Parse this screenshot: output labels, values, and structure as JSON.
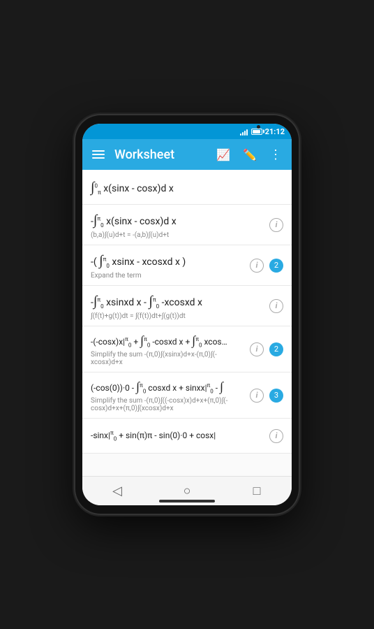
{
  "status_bar": {
    "time": "21:12"
  },
  "toolbar": {
    "title": "Worksheet"
  },
  "rows": [
    {
      "id": "row1",
      "expr": "∫ x(sinx - cosx)d x",
      "superscript": "0",
      "subscript": "π",
      "sub_text": "",
      "badge": null,
      "info": false
    },
    {
      "id": "row2",
      "expr": "-∫ x(sinx - cosx)d x",
      "superscript": "π",
      "subscript": "0",
      "sub_text": "(b,a)∫(u)d+t = -(a,b)∫(u)d+t",
      "badge": null,
      "info": true
    },
    {
      "id": "row3",
      "expr": "-(∫ xsinx - xcosxd x)",
      "superscript": "π",
      "subscript": "0",
      "sub_text": "Expand the term",
      "badge": "2",
      "info": true
    },
    {
      "id": "row4",
      "expr": "-∫ xsinxd x - ∫ -xcosxd x",
      "superscript": "π",
      "subscript": "0",
      "sub_text": "∫(f(t)+g(t))dt = ∫(f(t))dt+∫(g(t))dt",
      "badge": null,
      "info": true
    },
    {
      "id": "row5",
      "expr": "-(-cosx)x|  + ∫ -cosxd x + ∫ xcos…",
      "superscript": "π",
      "subscript": "0",
      "sub_text": "Simplify the sum -(π,0)∫(xsinx)d+x-(π,0)∫(-xcosx)d+x",
      "badge": "2",
      "info": true
    },
    {
      "id": "row6",
      "expr": "(-cos(0))·0 - ∫ cosxd x + sinxx|  - ∫",
      "superscript": "π",
      "subscript": "0",
      "sub_text": "Simplify the sum -(π,0)∫((-cosx)x)d+x+(π,0)∫(-cosx)d+x+(π,0)∫(xcosx)d+x",
      "badge": "3",
      "info": true
    },
    {
      "id": "row7",
      "expr": "-sinx|  + sin(π)π - sin(0)·0 + cosx|",
      "superscript": "π",
      "subscript": "0",
      "sub_text": "",
      "badge": null,
      "info": true
    }
  ],
  "nav": {
    "back": "◁",
    "home": "○",
    "recent": "□"
  }
}
